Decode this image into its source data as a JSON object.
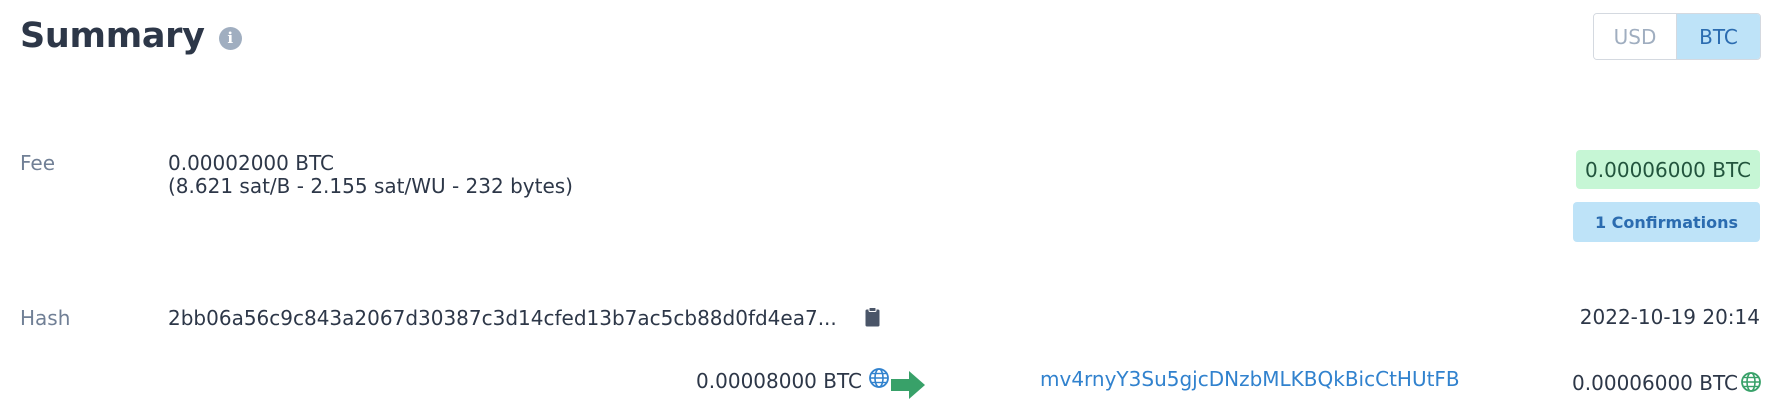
{
  "header": {
    "title": "Summary",
    "info_icon": "info-icon"
  },
  "currency_toggle": {
    "options": [
      "USD",
      "BTC"
    ],
    "selected": "BTC",
    "selected_color": "#bee3f8"
  },
  "fee": {
    "label": "Fee",
    "amount": "0.00002000 BTC",
    "details": "(8.621 sat/B - 2.155 sat/WU - 232 bytes)"
  },
  "status": {
    "total_amount": "0.00006000 BTC",
    "total_amount_color": "#c6f6d5",
    "confirmations": "1 Confirmations",
    "confirmations_color": "#bee3f8"
  },
  "hash": {
    "label": "Hash",
    "value": "2bb06a56c9c843a2067d30387c3d14cfed13b7ac5cb88d0fd4ea7...",
    "copy_icon": "clipboard-icon",
    "timestamp": "2022-10-19 20:14"
  },
  "transfer": {
    "input_amount": "0.00008000 BTC",
    "input_icon": "globe-icon",
    "arrow_icon": "arrow-right-icon",
    "arrow_color": "#38a169",
    "output_address": "mv4rnyY3Su5gjcDNzbMLKBQkBicCtHUtFB",
    "output_amount": "0.00006000 BTC",
    "output_icon": "globe-icon",
    "output_icon_color": "#38a169",
    "input_icon_color": "#3182ce"
  }
}
